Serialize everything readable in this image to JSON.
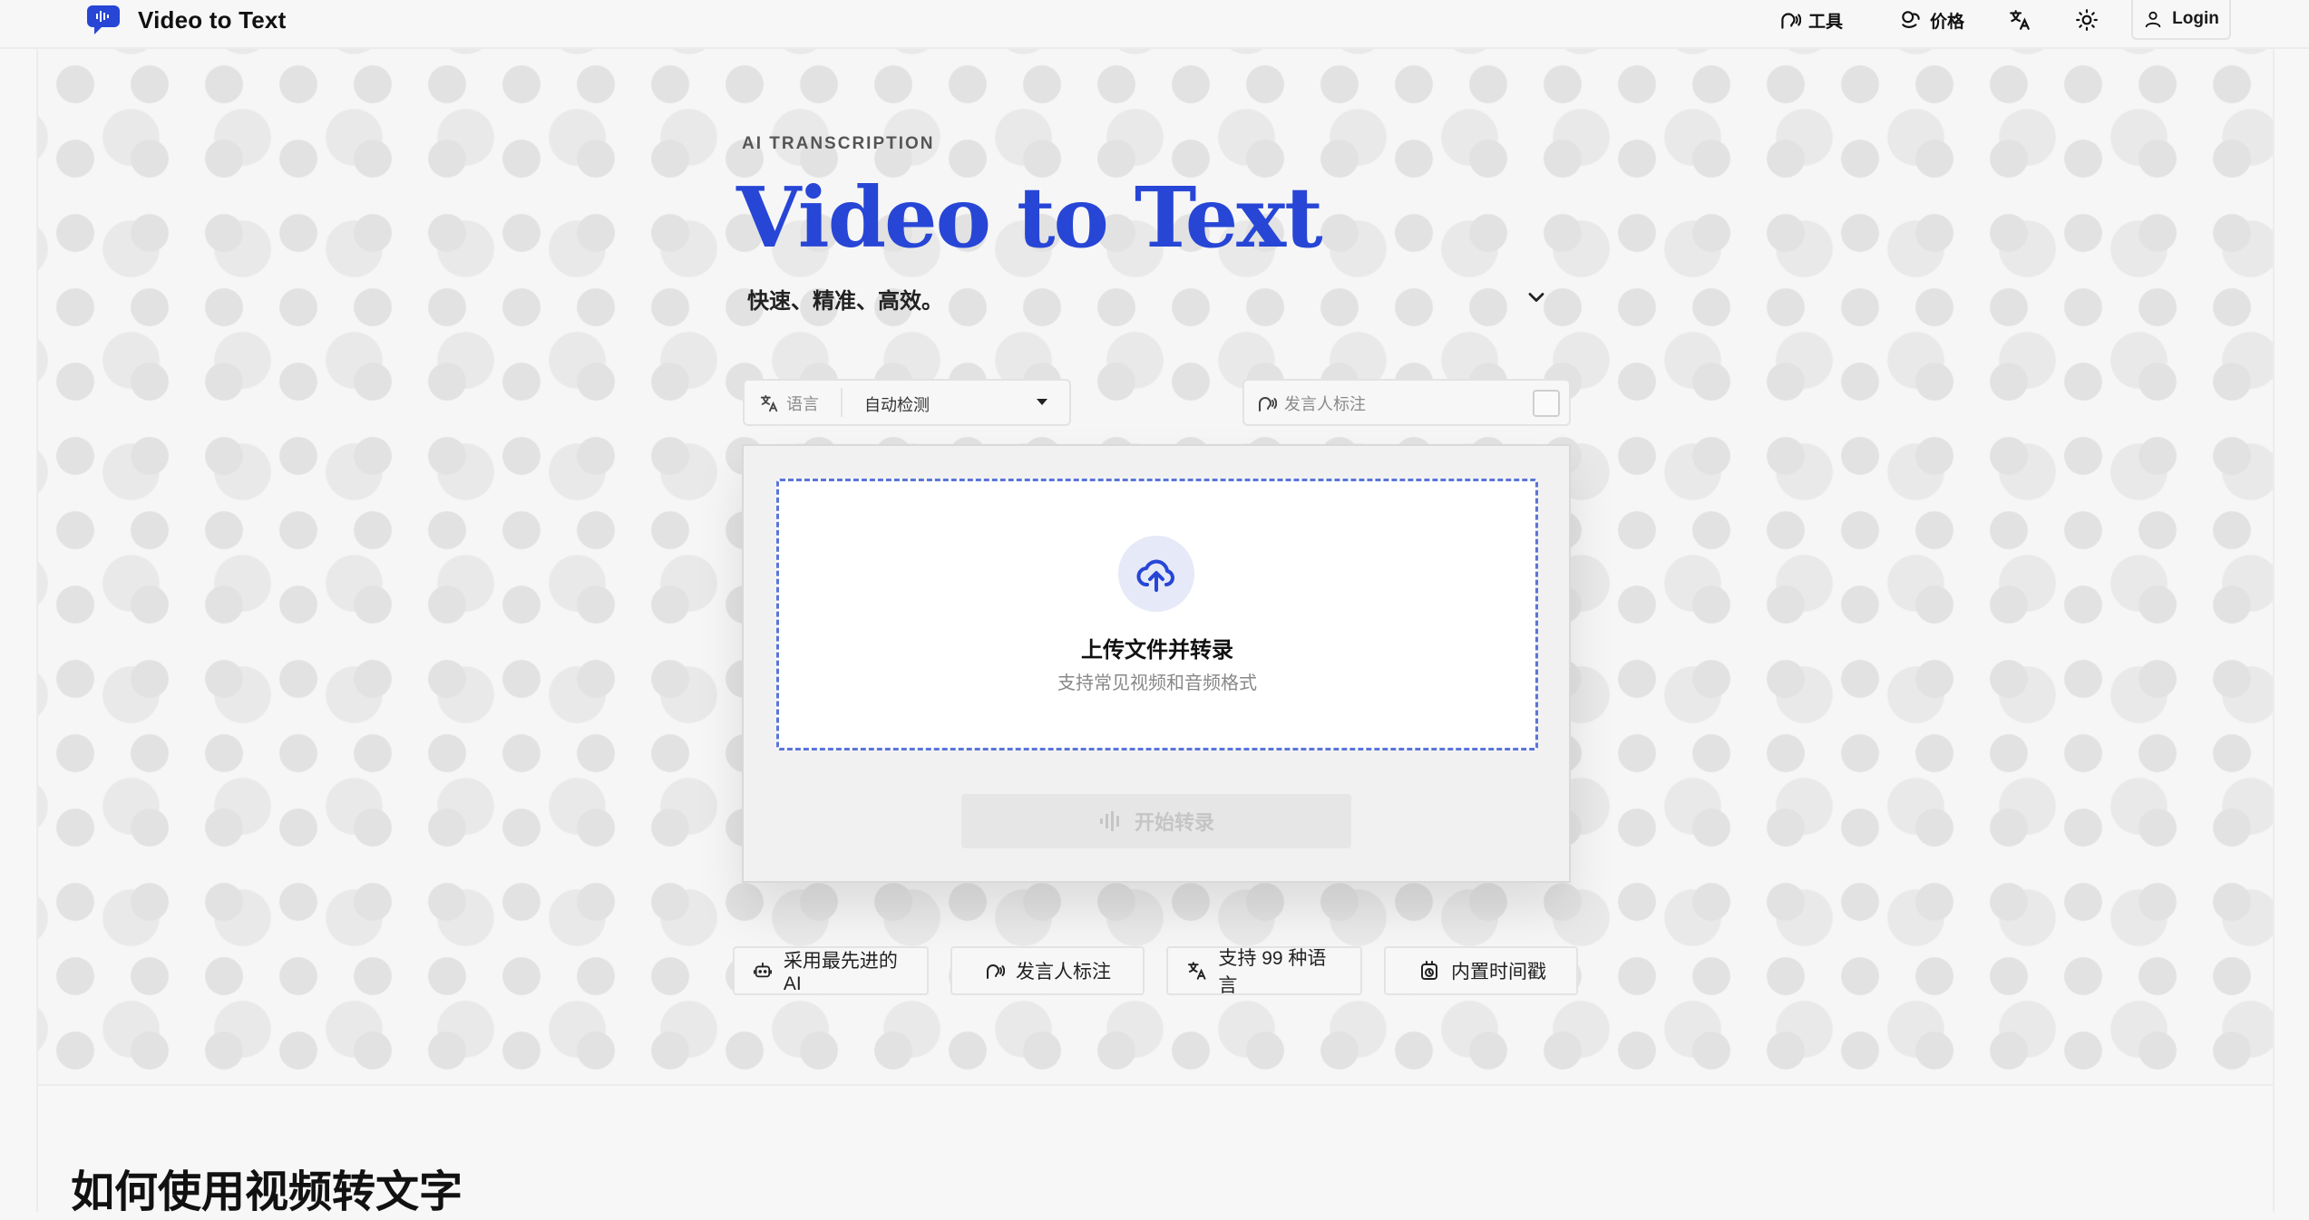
{
  "header": {
    "brand_name": "Video to Text",
    "nav": {
      "tools_label": "工具",
      "pricing_label": "价格",
      "language_icon": "translate-icon",
      "theme_icon": "sun-icon",
      "login_label": "Login"
    }
  },
  "hero": {
    "eyebrow": "AI TRANSCRIPTION",
    "title": "Video to Text",
    "subtitle": "快速、精准、高效。"
  },
  "options": {
    "language_label": "语言",
    "language_value": "自动检测",
    "speaker_label": "发言人标注",
    "speaker_checked": false
  },
  "upload": {
    "title": "上传文件并转录",
    "subtitle": "支持常见视频和音频格式",
    "start_label": "开始转录"
  },
  "features": [
    {
      "label": "采用最先进的 AI",
      "icon": "robot-icon"
    },
    {
      "label": "发言人标注",
      "icon": "speaker-icon"
    },
    {
      "label": "支持 99 种语言",
      "icon": "translate-icon"
    },
    {
      "label": "内置时间戳",
      "icon": "clock-icon"
    }
  ],
  "section": {
    "title": "如何使用视频转文字"
  },
  "colors": {
    "accent": "#2746d6",
    "dropzone_border": "#5a75d9",
    "background": "#f7f7f7"
  }
}
